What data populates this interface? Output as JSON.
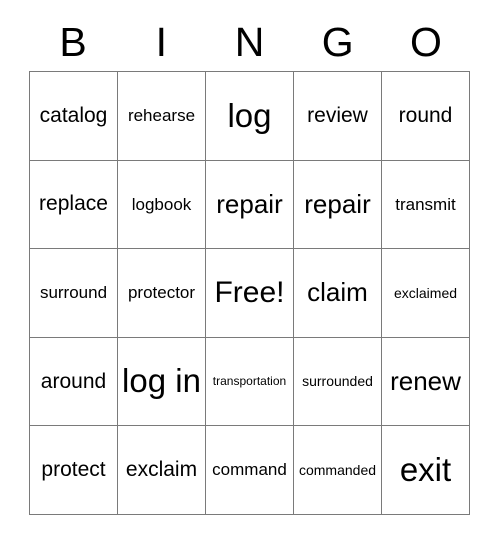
{
  "card": {
    "title": "BINGO",
    "header_letters": [
      "B",
      "I",
      "N",
      "G",
      "O"
    ],
    "grid_size": "5x5",
    "colors": {
      "background": "#ffffff",
      "text": "#000000",
      "border": "#7a7a7a"
    },
    "rows": [
      [
        {
          "text": "catalog",
          "size": "sz-m"
        },
        {
          "text": "rehearse",
          "size": "sz-s"
        },
        {
          "text": "log",
          "size": "sz-xxl"
        },
        {
          "text": "review",
          "size": "sz-m"
        },
        {
          "text": "round",
          "size": "sz-m"
        }
      ],
      [
        {
          "text": "replace",
          "size": "sz-m"
        },
        {
          "text": "logbook",
          "size": "sz-s"
        },
        {
          "text": "repair",
          "size": "sz-l"
        },
        {
          "text": "repair",
          "size": "sz-l"
        },
        {
          "text": "transmit",
          "size": "sz-s"
        }
      ],
      [
        {
          "text": "surround",
          "size": "sz-s"
        },
        {
          "text": "protector",
          "size": "sz-s"
        },
        {
          "text": "Free!",
          "size": "sz-xl"
        },
        {
          "text": "claim",
          "size": "sz-l"
        },
        {
          "text": "exclaimed",
          "size": "sz-xs"
        }
      ],
      [
        {
          "text": "around",
          "size": "sz-m"
        },
        {
          "text": "log in",
          "size": "sz-xxl"
        },
        {
          "text": "transportation",
          "size": "sz-xxs"
        },
        {
          "text": "surrounded",
          "size": "sz-xs"
        },
        {
          "text": "renew",
          "size": "sz-l"
        }
      ],
      [
        {
          "text": "protect",
          "size": "sz-m"
        },
        {
          "text": "exclaim",
          "size": "sz-m"
        },
        {
          "text": "command",
          "size": "sz-s"
        },
        {
          "text": "commanded",
          "size": "sz-xs"
        },
        {
          "text": "exit",
          "size": "sz-xxl"
        }
      ]
    ]
  }
}
